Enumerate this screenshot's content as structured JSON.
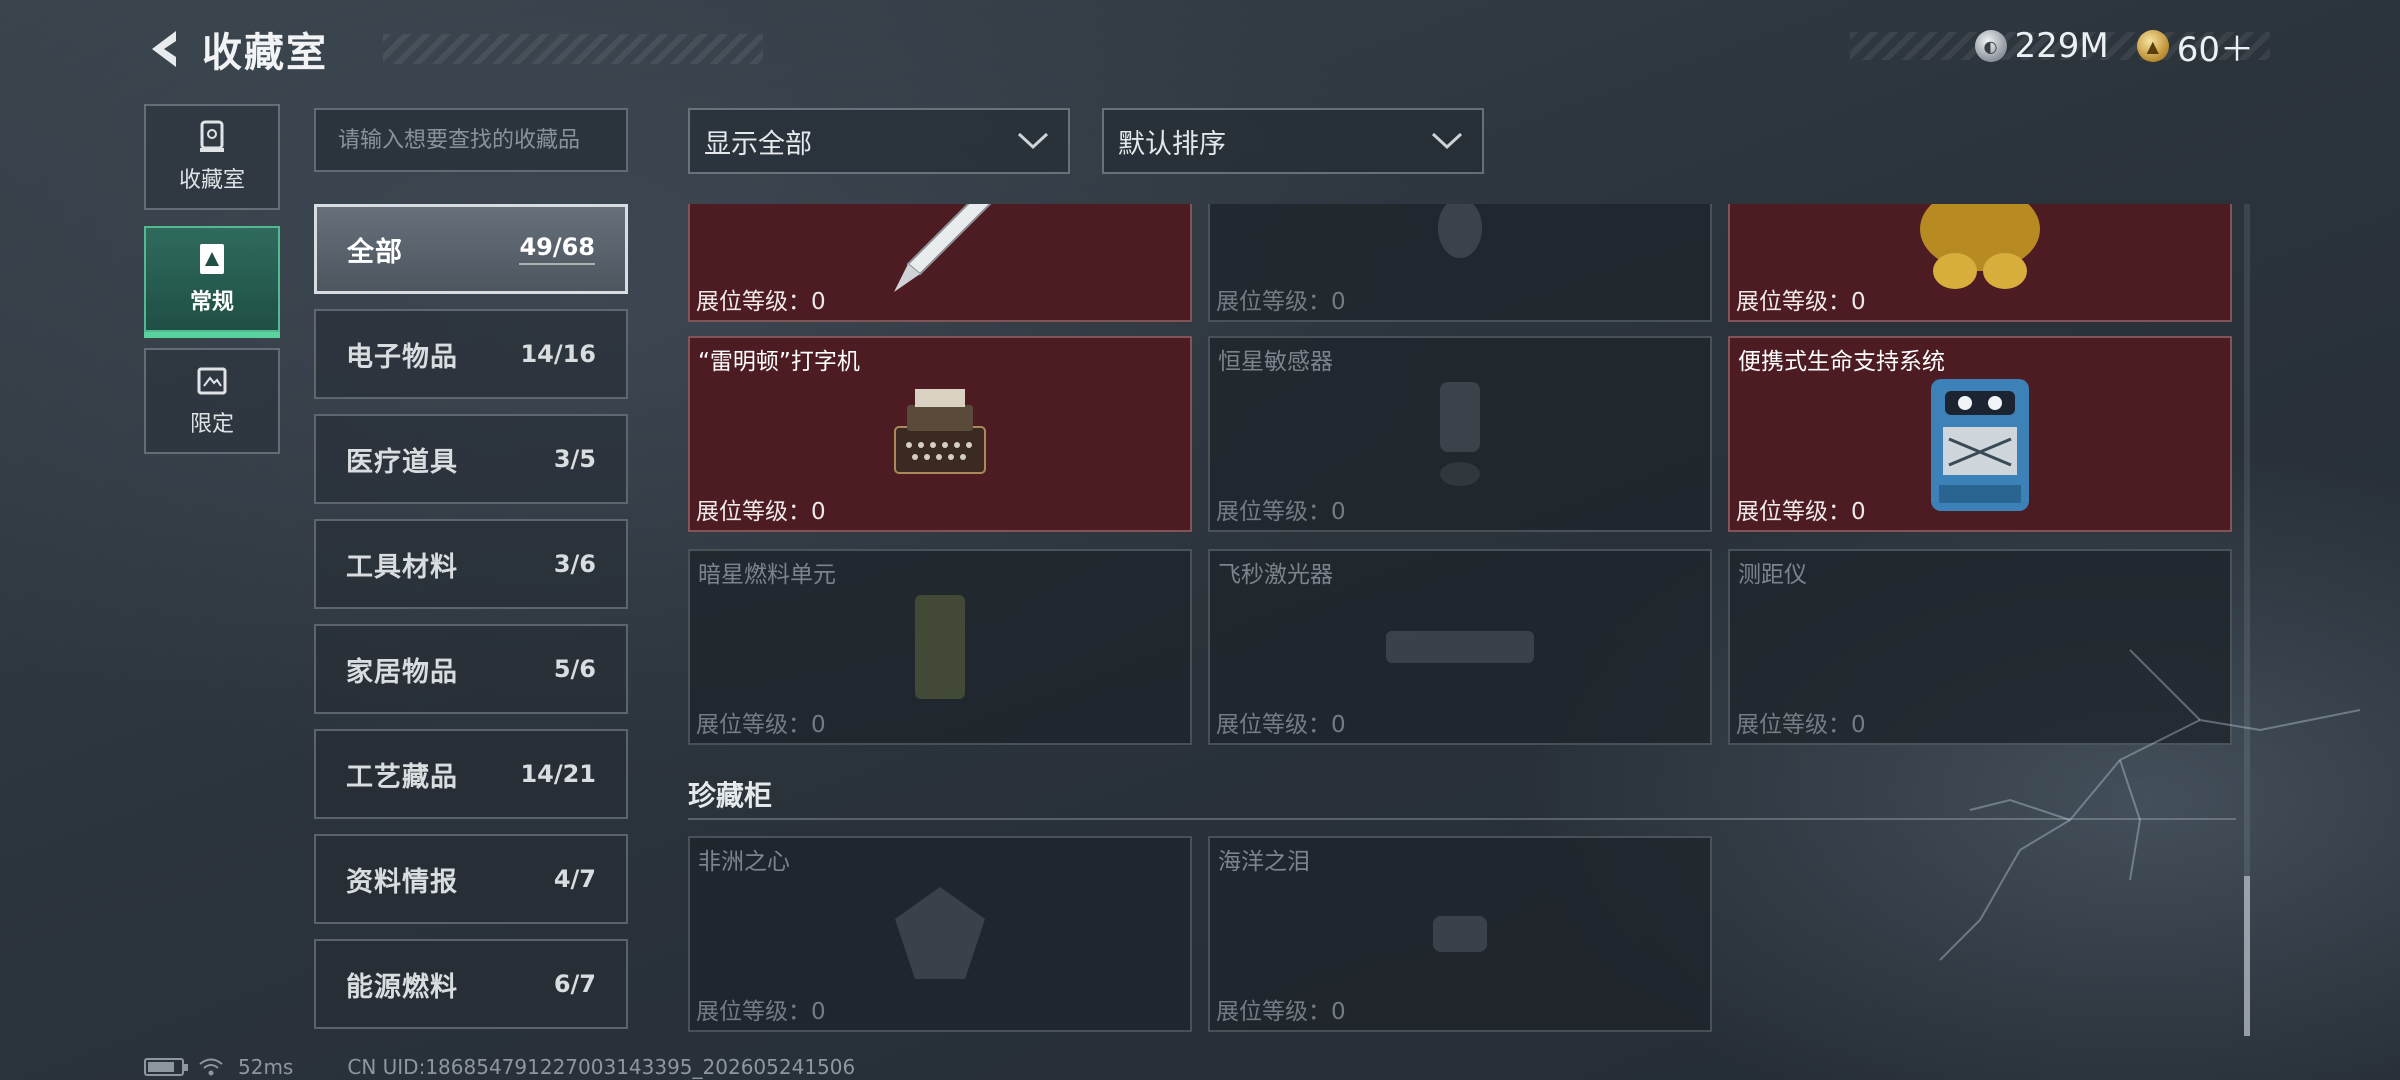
{
  "header": {
    "title": "收藏室",
    "currencies": [
      {
        "icon": "silver-coin-icon",
        "value": "229M"
      },
      {
        "icon": "gold-coin-icon",
        "value": "60＋"
      }
    ]
  },
  "nav": {
    "tabs": [
      {
        "label": "收藏室",
        "icon": "trophy-icon"
      },
      {
        "label": "常规",
        "icon": "regular-collection-icon",
        "active": true
      },
      {
        "label": "限定",
        "icon": "limited-collection-icon"
      }
    ]
  },
  "search": {
    "placeholder": "请输入想要查找的收藏品"
  },
  "categories": [
    {
      "name": "全部",
      "count": "49/68",
      "active": true
    },
    {
      "name": "电子物品",
      "count": "14/16"
    },
    {
      "name": "医疗道具",
      "count": "3/5"
    },
    {
      "name": "工具材料",
      "count": "3/6"
    },
    {
      "name": "家居物品",
      "count": "5/6"
    },
    {
      "name": "工艺藏品",
      "count": "14/21"
    },
    {
      "name": "资料情报",
      "count": "4/7"
    },
    {
      "name": "能源燃料",
      "count": "6/7"
    }
  ],
  "filters": {
    "display": "显示全部",
    "sort": "默认排序"
  },
  "level_label": "展位等级：0",
  "items": [
    {
      "name": "",
      "collected": true,
      "art": "pen"
    },
    {
      "name": "",
      "collected": false,
      "art": "grenade"
    },
    {
      "name": "",
      "collected": true,
      "art": "gold-statue"
    },
    {
      "name": "“雷明顿”打字机",
      "collected": true,
      "art": "typewriter"
    },
    {
      "name": "恒星敏感器",
      "collected": false,
      "art": "sensor"
    },
    {
      "name": "便携式生命支持系统",
      "collected": true,
      "art": "life-support"
    },
    {
      "name": "暗星燃料单元",
      "collected": false,
      "art": "fuel-cell"
    },
    {
      "name": "飞秒激光器",
      "collected": false,
      "art": "laser"
    },
    {
      "name": "测距仪",
      "collected": false,
      "art": "rangefinder"
    }
  ],
  "showcase": {
    "title": "珍藏柜",
    "items": [
      {
        "name": "非洲之心",
        "collected": false
      },
      {
        "name": "海洋之泪",
        "collected": false
      }
    ]
  },
  "status": {
    "ping": "52ms",
    "uid": "CN UID:18685479122700314339​5_202605241506"
  }
}
